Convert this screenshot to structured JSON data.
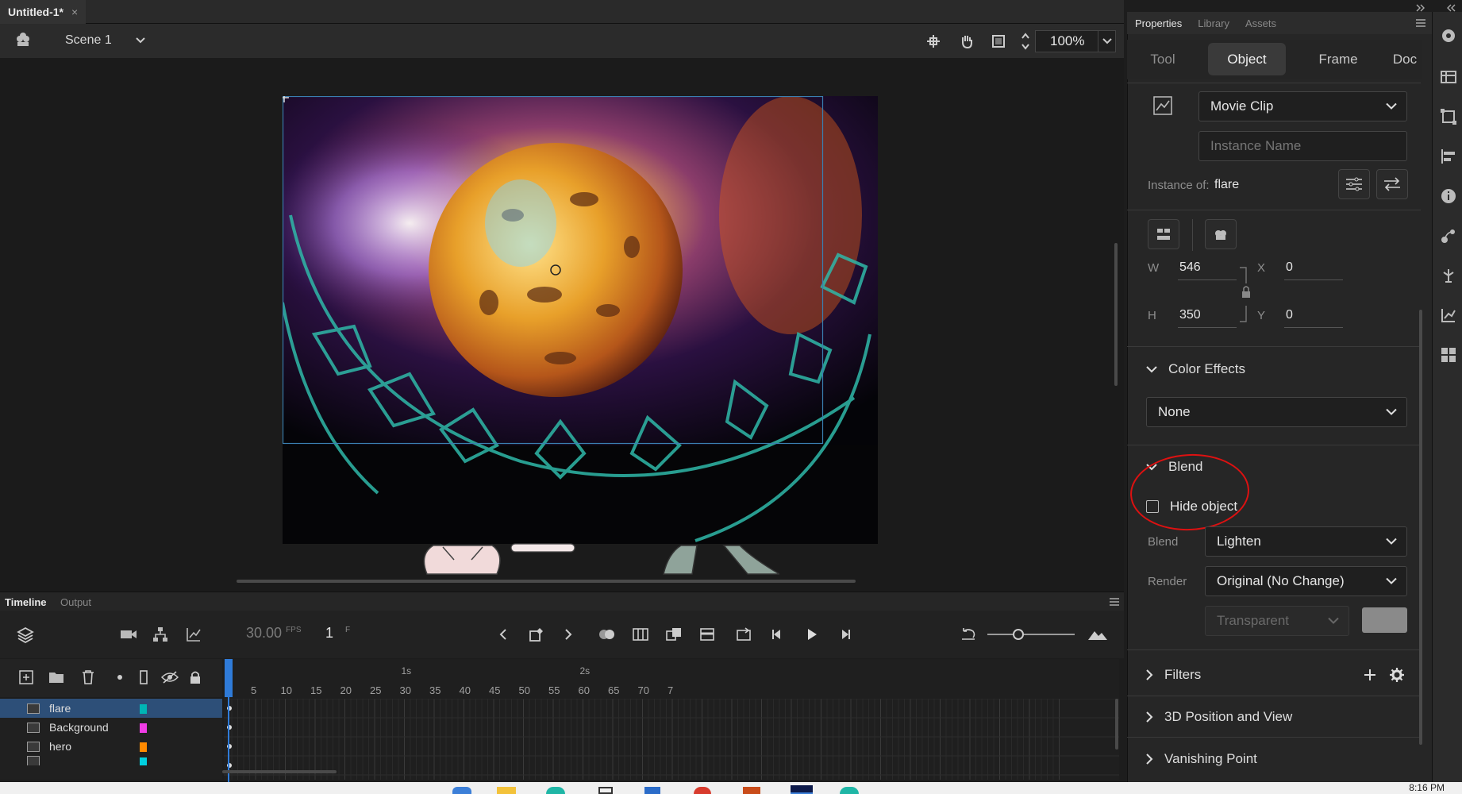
{
  "document": {
    "tab_title": "Untitled-1*",
    "close_glyph": "×"
  },
  "scene": {
    "name": "Scene 1"
  },
  "view": {
    "zoom": "100%"
  },
  "timeline": {
    "tabs": [
      "Timeline",
      "Output"
    ],
    "fps_value": "30.00",
    "fps_unit": "FPS",
    "current_frame": "1",
    "frame_unit": "F",
    "ruler": {
      "seconds": [
        {
          "label": "1s",
          "frame": 30
        },
        {
          "label": "2s",
          "frame": 60
        }
      ],
      "frames": [
        "5",
        "10",
        "15",
        "20",
        "25",
        "30",
        "35",
        "40",
        "45",
        "50",
        "55",
        "60",
        "65",
        "70",
        "7"
      ]
    },
    "layers": [
      {
        "name": "flare",
        "color": "#00b5b5",
        "selected": true
      },
      {
        "name": "Background",
        "color": "#f03ce6",
        "selected": false
      },
      {
        "name": "hero",
        "color": "#ff8a00",
        "selected": false
      },
      {
        "name": "",
        "color": "#00d0e0",
        "selected": false
      }
    ]
  },
  "properties": {
    "panel_tabs": [
      "Properties",
      "Library",
      "Assets"
    ],
    "segments": [
      "Tool",
      "Object",
      "Frame",
      "Doc"
    ],
    "active_segment": "Object",
    "symbol_type": "Movie Clip",
    "instance_name_placeholder": "Instance Name",
    "instance_of_label": "Instance of:",
    "instance_of_value": "flare",
    "size": {
      "w_label": "W",
      "w": "546",
      "h_label": "H",
      "h": "350",
      "x_label": "X",
      "x": "0",
      "y_label": "Y",
      "y": "0"
    },
    "color_effects": {
      "title": "Color Effects",
      "value": "None"
    },
    "blend_section": {
      "title": "Blend",
      "hide_object_label": "Hide object",
      "hide_object_checked": false,
      "blend_label": "Blend",
      "blend_value": "Lighten",
      "render_label": "Render",
      "render_value": "Original (No Change)",
      "transparent_value": "Transparent"
    },
    "filters_title": "Filters",
    "position_3d_title": "3D Position and View",
    "vanishing_point_title": "Vanishing Point"
  },
  "taskbar": {
    "time": "8:16 PM"
  },
  "colors": {
    "accent": "#2d4f78",
    "highlight": "#dd1111",
    "panel": "#262626"
  }
}
